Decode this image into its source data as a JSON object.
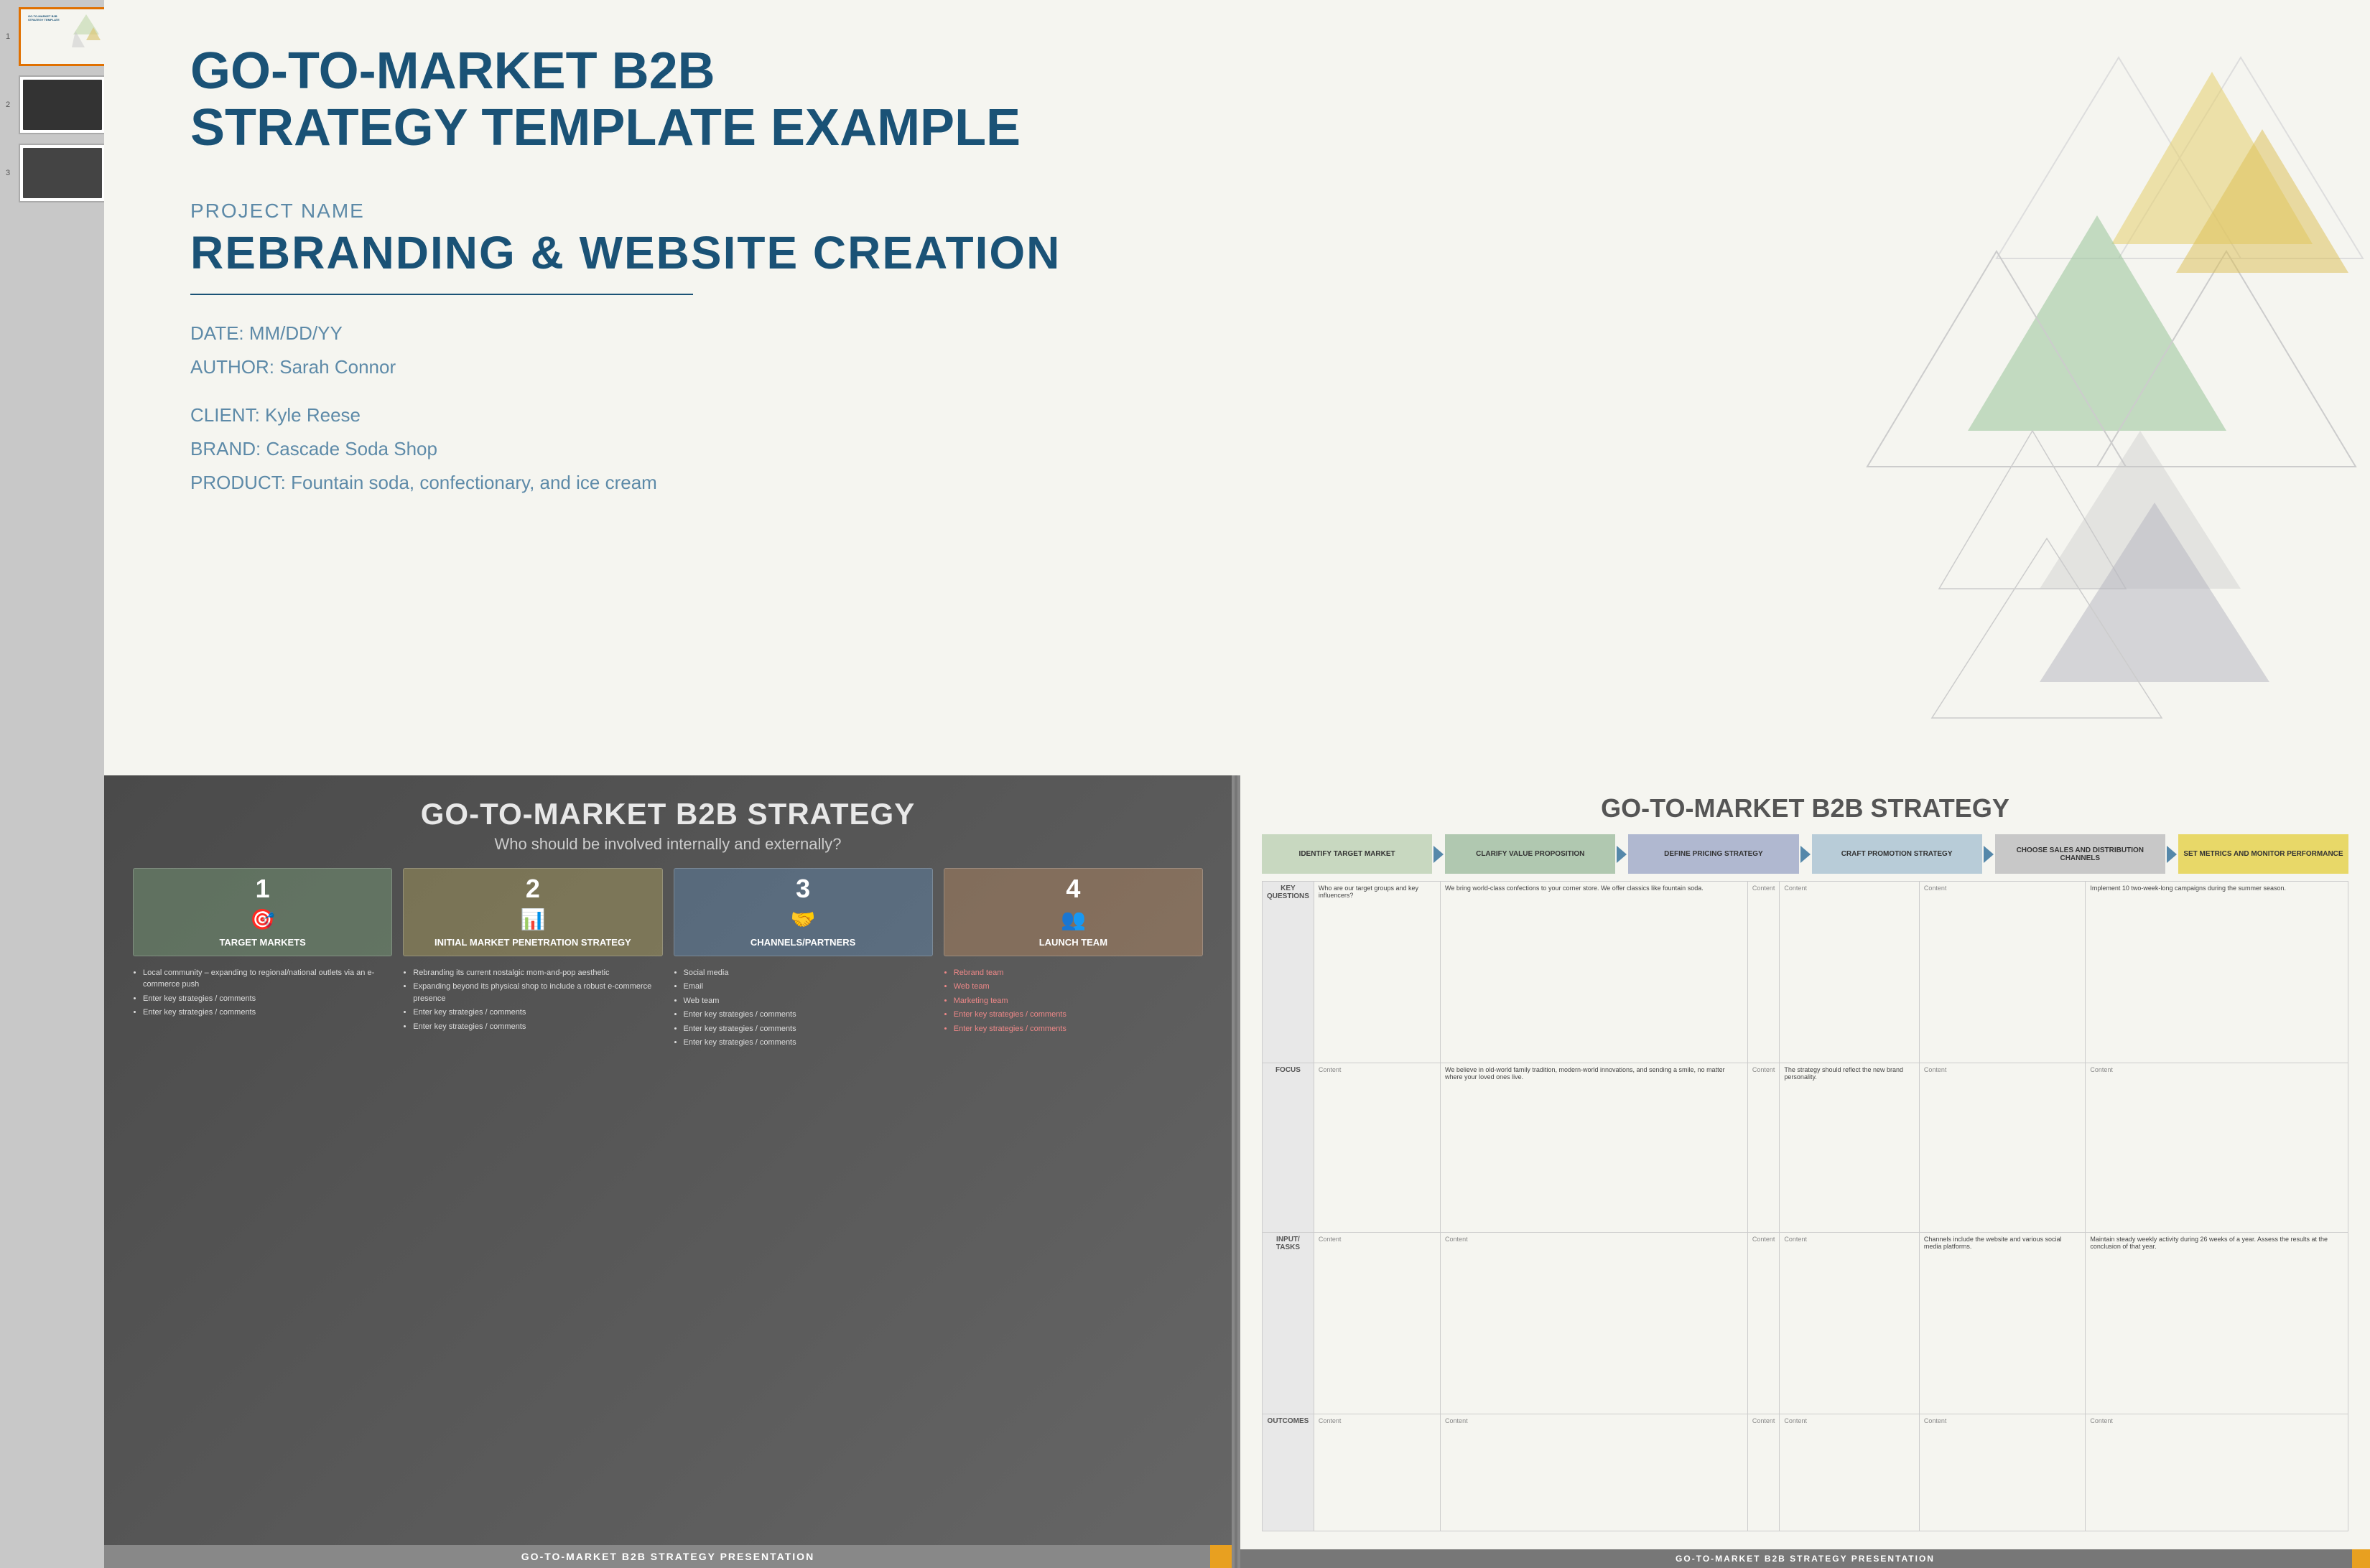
{
  "sidebar": {
    "slides": [
      {
        "num": "1",
        "active": true
      },
      {
        "num": "2",
        "active": false
      },
      {
        "num": "3",
        "active": false
      }
    ]
  },
  "slide1": {
    "title_line1": "GO-TO-MARKET B2B",
    "title_line2": "STRATEGY TEMPLATE EXAMPLE",
    "project_label": "PROJECT NAME",
    "project_name": "REBRANDING & WEBSITE CREATION",
    "date": "DATE: MM/DD/YY",
    "author": "AUTHOR: Sarah Connor",
    "client": "CLIENT: Kyle Reese",
    "brand": "BRAND: Cascade Soda Shop",
    "product": "PRODUCT: Fountain soda, confectionary, and ice cream"
  },
  "slide2": {
    "title": "GO-TO-MARKET B2B STRATEGY",
    "subtitle": "Who should be involved internally and externally?",
    "steps": [
      {
        "num": "1",
        "icon": "🎯",
        "label": "TARGET MARKETS",
        "color": "green"
      },
      {
        "num": "2",
        "icon": "📊",
        "label": "INITIAL MARKET PENETRATION STRATEGY",
        "color": "yellow"
      },
      {
        "num": "3",
        "icon": "🤝",
        "label": "CHANNELS/PARTNERS",
        "color": "blue"
      },
      {
        "num": "4",
        "icon": "👥",
        "label": "LAUNCH TEAM",
        "color": "orange"
      }
    ],
    "bullets": [
      {
        "color": "white",
        "items": [
          "Local community – expanding to regional/national outlets via an e-commerce push",
          "Enter key strategies / comments",
          "Enter key strategies / comments"
        ]
      },
      {
        "color": "white",
        "items": [
          "Rebranding its current nostalgic mom-and-pop aesthetic",
          "Expanding beyond its physical shop to include a robust e-commerce presence",
          "Enter key strategies / comments",
          "Enter key strategies / comments"
        ]
      },
      {
        "color": "white",
        "items": [
          "Social media",
          "Email",
          "Web team",
          "Enter key strategies / comments",
          "Enter key strategies / comments",
          "Enter key strategies / comments"
        ]
      },
      {
        "color": "red",
        "items": [
          "Rebrand team",
          "Web team",
          "Marketing team",
          "Enter key strategies / comments",
          "Enter key strategies / comments"
        ]
      }
    ],
    "footer": "GO-TO-MARKET B2B STRATEGY PRESENTATION"
  },
  "slide3": {
    "title": "GO-TO-MARKET B2B STRATEGY",
    "process_steps": [
      {
        "label": "IDENTIFY TARGET MARKET",
        "color": "green"
      },
      {
        "label": "CLARIFY VALUE PROPOSITION",
        "color": "teal"
      },
      {
        "label": "DEFINE PRICING STRATEGY",
        "color": "blue"
      },
      {
        "label": "CRAFT PROMOTION STRATEGY",
        "color": "lblue"
      },
      {
        "label": "CHOOSE SALES AND DISTRIBUTION CHANNELS",
        "color": "gray"
      },
      {
        "label": "SET METRICS AND MONITOR PERFORMANCE",
        "color": "yellow"
      }
    ],
    "table": {
      "row_headers": [
        "KEY QUESTIONS",
        "FOCUS",
        "INPUT/ TASKS",
        "OUTCOMES"
      ],
      "col_headers": [
        "",
        "IDENTIFY TARGET MARKET",
        "CLARIFY VALUE PROPOSITION",
        "DEFINE PRICING STRATEGY",
        "CRAFT PROMOTION STRATEGY",
        "CHOOSE SALES AND DISTRIBUTION CHANNELS",
        "SET METRICS AND MONITOR PERFORMANCE"
      ],
      "rows": [
        [
          "KEY QUESTIONS",
          "Who are our target groups and key influencers?",
          "We bring world-class confections to your corner store. We offer classics like fountain soda.",
          "Content",
          "Content",
          "Content",
          "Implement 10 two-week-long campaigns during the summer season."
        ],
        [
          "FOCUS",
          "Content",
          "We believe in old-world family tradition, modern-world innovations, and sending a smile, no matter where your loved ones live.",
          "Content",
          "The strategy should reflect the new brand personality.",
          "Content",
          "Content"
        ],
        [
          "INPUT/ TASKS",
          "Content",
          "Content",
          "Content",
          "Content",
          "Channels include the website and various social media platforms.",
          "Maintain steady weekly activity during 26 weeks of a year. Assess the results at the conclusion of that year."
        ],
        [
          "OUTCOMES",
          "Content",
          "Content",
          "Content",
          "Content",
          "Content",
          "Content"
        ]
      ]
    },
    "footer": "GO-TO-MARKET B2B STRATEGY PRESENTATION"
  }
}
